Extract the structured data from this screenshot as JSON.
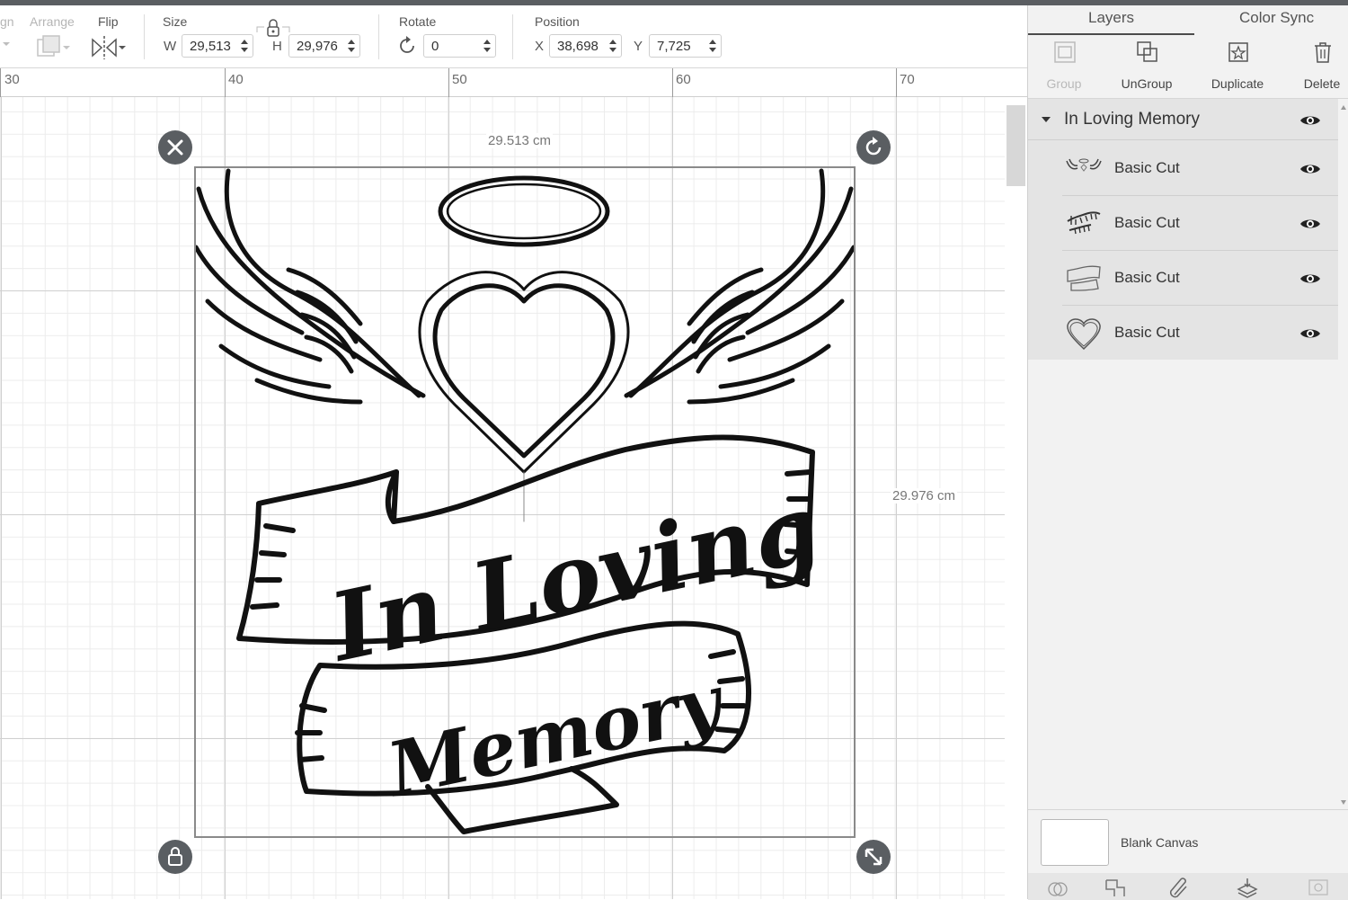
{
  "toolbar": {
    "align_label": "gn",
    "arrange_label": "Arrange",
    "flip_label": "Flip",
    "size_label": "Size",
    "width_prefix": "W",
    "width_value": "29,513",
    "height_prefix": "H",
    "height_value": "29,976",
    "rotate_label": "Rotate",
    "rotate_value": "0",
    "position_label": "Position",
    "x_prefix": "X",
    "x_value": "38,698",
    "y_prefix": "Y",
    "y_value": "7,725"
  },
  "ruler": {
    "marks": [
      "30",
      "40",
      "50",
      "60",
      "70"
    ]
  },
  "canvas": {
    "width_dimension": "29.513 cm",
    "height_dimension": "29.976 cm",
    "design_text_line1": "In Loving",
    "design_text_line2": "Memory"
  },
  "panel": {
    "tabs": {
      "layers": "Layers",
      "color_sync": "Color Sync"
    },
    "actions": {
      "group": "Group",
      "ungroup": "UnGroup",
      "duplicate": "Duplicate",
      "delete": "Delete"
    },
    "group_name": "In Loving Memory",
    "layers": [
      {
        "name": "Basic Cut",
        "thumb": "wings-halo-thumb"
      },
      {
        "name": "Basic Cut",
        "thumb": "text-thumb"
      },
      {
        "name": "Basic Cut",
        "thumb": "banner-thumb"
      },
      {
        "name": "Basic Cut",
        "thumb": "heart-thumb"
      }
    ],
    "blank_canvas": "Blank Canvas"
  },
  "colors": {
    "accent_dark": "#5a5e62",
    "panel_bg": "#f2f2f2",
    "layer_bg": "#e4e4e4"
  }
}
